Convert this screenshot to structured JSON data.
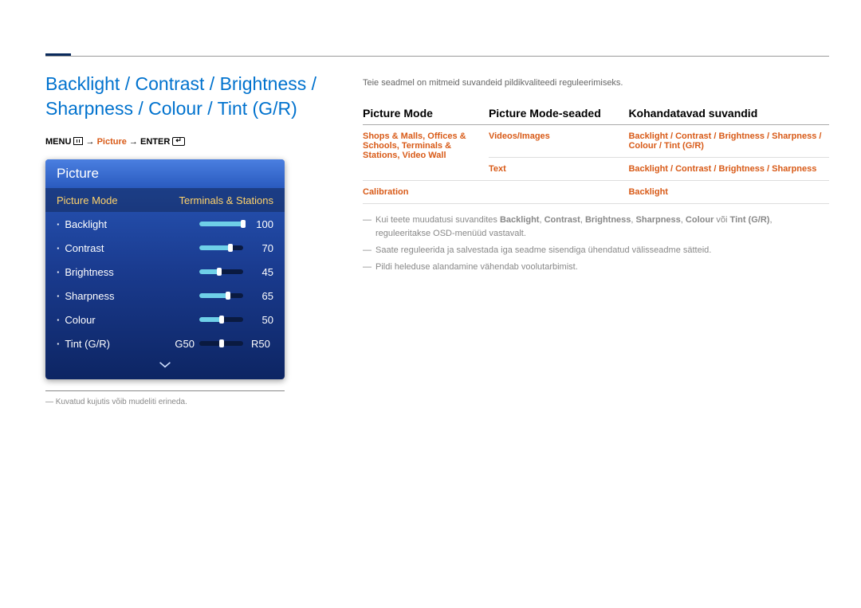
{
  "title": "Backlight / Contrast / Brightness / Sharpness / Colour / Tint (G/R)",
  "menu_path": {
    "menu": "MENU",
    "picture": "Picture",
    "enter": "ENTER",
    "arrow": " → "
  },
  "osd": {
    "header": "Picture",
    "selected_label": "Picture Mode",
    "selected_value": "Terminals & Stations",
    "rows": [
      {
        "label": "Backlight",
        "value": "100",
        "pct": 100
      },
      {
        "label": "Contrast",
        "value": "70",
        "pct": 70
      },
      {
        "label": "Brightness",
        "value": "45",
        "pct": 45
      },
      {
        "label": "Sharpness",
        "value": "65",
        "pct": 65
      },
      {
        "label": "Colour",
        "value": "50",
        "pct": 50
      }
    ],
    "tint": {
      "label": "Tint (G/R)",
      "left": "G50",
      "right": "R50",
      "pct": 50
    }
  },
  "footnote": "Kuvatud kujutis võib mudeliti erineda.",
  "intro": "Teie seadmel on mitmeid suvandeid pildikvaliteedi reguleerimiseks.",
  "table": {
    "headers": [
      "Picture Mode",
      "Picture Mode-seaded",
      "Kohandatavad suvandid"
    ],
    "rows": [
      {
        "c1": "Shops & Malls, Offices & Schools, Terminals & Stations, Video Wall",
        "c2": "Videos/Images",
        "c3": "Backlight / Contrast / Brightness / Sharpness / Colour / Tint (G/R)"
      },
      {
        "c1": "",
        "c2": "Text",
        "c3": "Backlight / Contrast / Brightness / Sharpness"
      },
      {
        "c1": "Calibration",
        "c2": "",
        "c3": "Backlight"
      }
    ]
  },
  "notes": [
    "Kui teete muudatusi suvandites <b>Backlight</b>, <b>Contrast</b>, <b>Brightness</b>, <b>Sharpness</b>, <b>Colour</b> või <b>Tint (G/R)</b>, reguleeritakse OSD-menüüd vastavalt.",
    "Saate reguleerida ja salvestada iga seadme sisendiga ühendatud välisseadme sätteid.",
    "Pildi heleduse alandamine vähendab voolutarbimist."
  ]
}
